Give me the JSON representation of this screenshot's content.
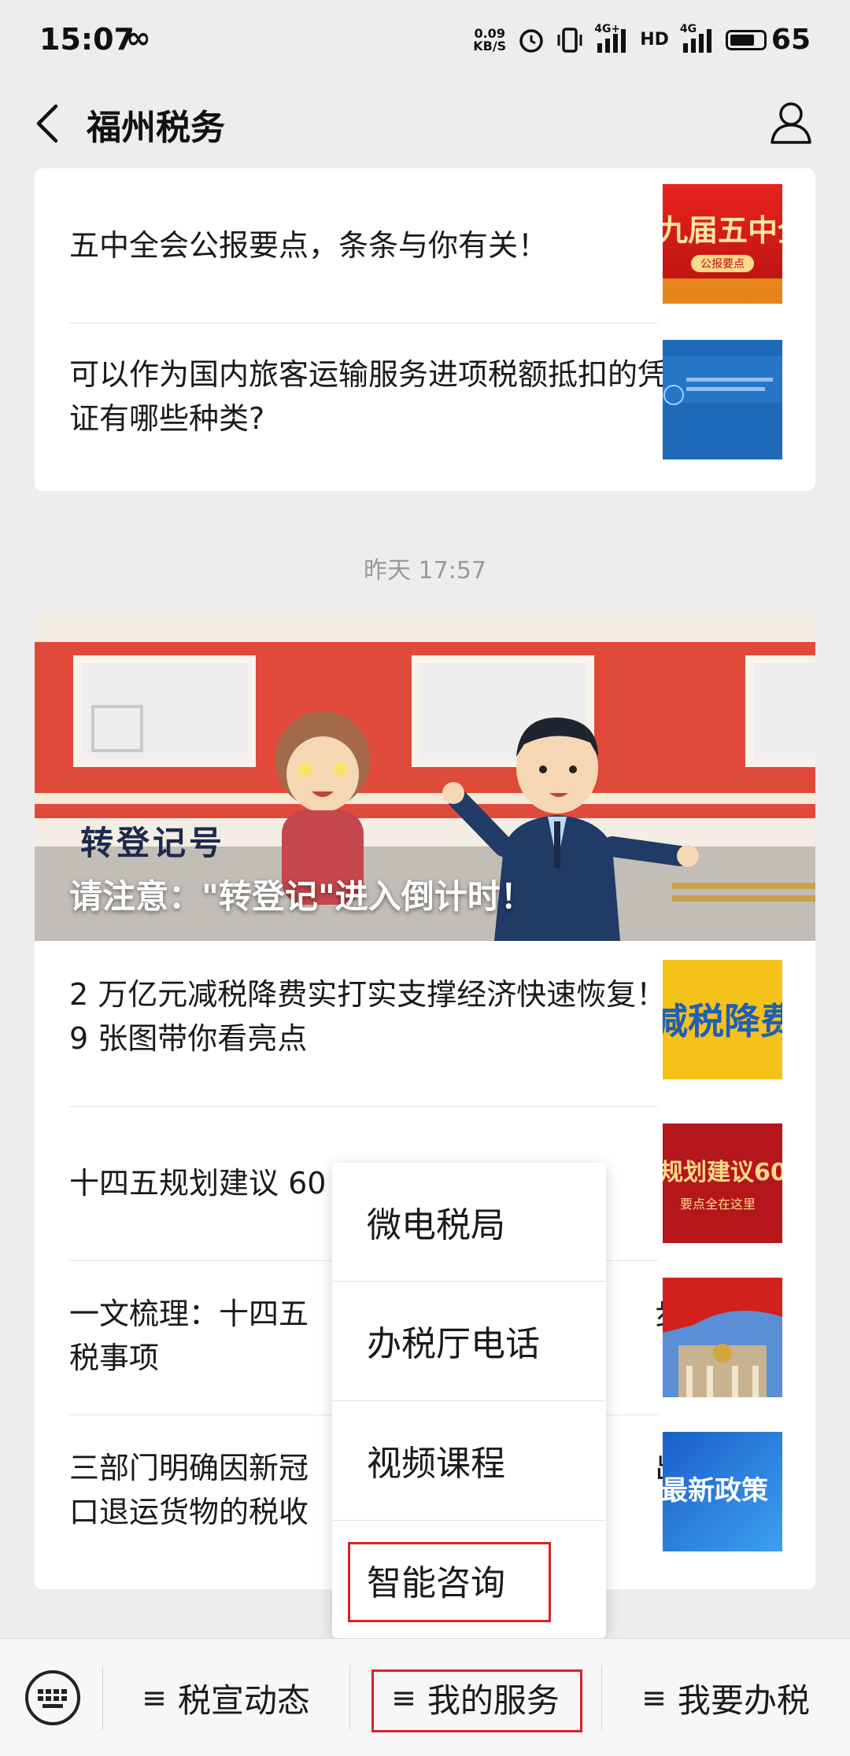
{
  "status_bar": {
    "time": "15:07",
    "infinity": "∞",
    "net_speed_value": "0.09",
    "net_speed_unit": "KB/S",
    "network_1": "4G+",
    "hd": "HD",
    "network_2": "4G",
    "battery": "65"
  },
  "nav": {
    "title": "福州税务"
  },
  "articles_top": [
    {
      "title": "五中全会公报要点，条条与你有关！",
      "thumb_text": "九届五中全",
      "thumb_sub": "公报要点"
    },
    {
      "title": "可以作为国内旅客运输服务进项税额抵扣的凭证有哪些种类?",
      "thumb_text": ""
    }
  ],
  "timestamp": "昨天 17:57",
  "hero": {
    "label": "转登记号",
    "caption": "请注意：\"转登记\"进入倒计时！"
  },
  "articles_bottom": [
    {
      "title": "2 万亿元减税降费实打实支撑经济快速恢复！9 张图带你看亮点",
      "thumb_text": "减税降费"
    },
    {
      "title": "十四五规划建议 60",
      "thumb_text": "规划建议60",
      "thumb_sub": "要点全在这里"
    },
    {
      "title": "一文梳理：十四五",
      "title_tail": "步",
      "title_line2": "税事项",
      "thumb_text": ""
    },
    {
      "title": "三部门明确因新冠",
      "title_tail": "出",
      "title_line2": "口退运货物的税收",
      "thumb_text": "最新政策"
    }
  ],
  "popup_menu": {
    "items": [
      "微电税局",
      "办税厅电话",
      "视频课程",
      "智能咨询"
    ]
  },
  "bottom_menu": {
    "items": [
      "税宣动态",
      "我的服务",
      "我要办税"
    ],
    "hamburger": "≡"
  },
  "colors": {
    "highlight": "#d6232b",
    "background": "#ededed"
  }
}
